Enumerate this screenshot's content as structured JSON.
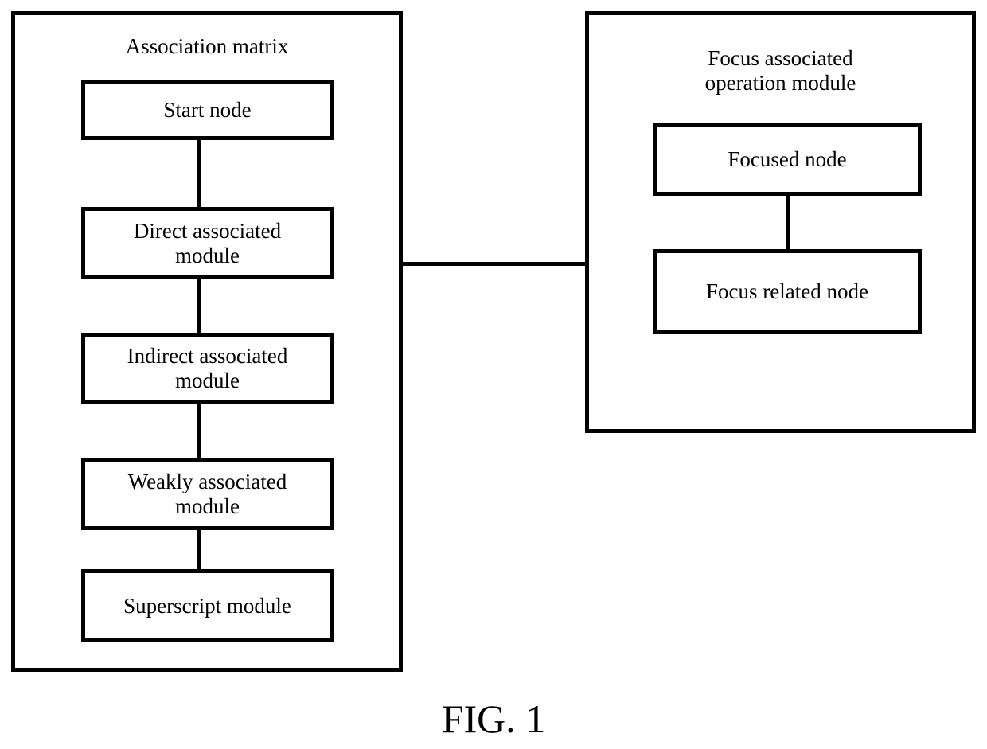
{
  "left_group": {
    "title": "Association matrix",
    "nodes": [
      {
        "label": "Start node"
      },
      {
        "label": "Direct associated\nmodule"
      },
      {
        "label": "Indirect associated\nmodule"
      },
      {
        "label": "Weakly associated\nmodule"
      },
      {
        "label": "Superscript module"
      }
    ]
  },
  "right_group": {
    "title": "Focus associated\noperation module",
    "nodes": [
      {
        "label": "Focused node"
      },
      {
        "label": "Focus related node"
      }
    ]
  },
  "caption": "FIG. 1"
}
